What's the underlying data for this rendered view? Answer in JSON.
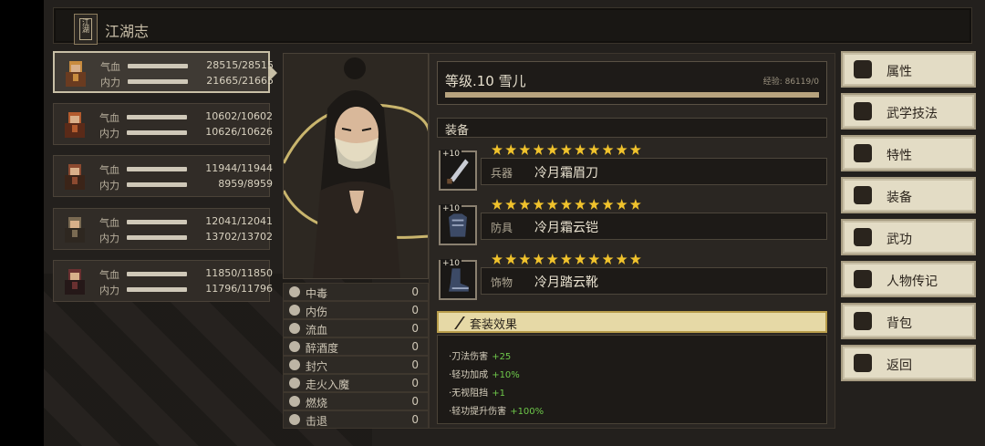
{
  "header": {
    "title": "江湖志",
    "book_icon": "book-icon"
  },
  "labels": {
    "hp": "气血",
    "mp": "内力"
  },
  "characters": [
    {
      "hp": "28515/28515",
      "mp": "21665/21665",
      "selected": true
    },
    {
      "hp": "10602/10602",
      "mp": "10626/10626"
    },
    {
      "hp": "11944/11944",
      "mp": "8959/8959"
    },
    {
      "hp": "12041/12041",
      "mp": "13702/13702"
    },
    {
      "hp": "11850/11850",
      "mp": "11796/11796"
    }
  ],
  "status_effects": [
    {
      "name": "中毒",
      "value": "0",
      "icon": "skull-icon"
    },
    {
      "name": "内伤",
      "value": "0",
      "icon": "broken-heart-icon"
    },
    {
      "name": "流血",
      "value": "0",
      "icon": "blood-drop-icon"
    },
    {
      "name": "醉酒度",
      "value": "0",
      "icon": "wine-icon"
    },
    {
      "name": "封穴",
      "value": "0",
      "icon": "needle-icon"
    },
    {
      "name": "走火入魔",
      "value": "0",
      "icon": "demon-icon"
    },
    {
      "name": "燃烧",
      "value": "0",
      "icon": "fire-icon"
    },
    {
      "name": "击退",
      "value": "0",
      "icon": "boot-icon"
    }
  ],
  "profile": {
    "level_name": "等级.10 雪儿",
    "exp": "经验: 86119/0",
    "exp_fill": 1.0
  },
  "equipment": {
    "section_title": "装备",
    "items": [
      {
        "plus": "+10",
        "stars": 11,
        "type": "兵器",
        "name": "冷月霜眉刀",
        "icon": "blade-icon"
      },
      {
        "plus": "+10",
        "stars": 11,
        "type": "防具",
        "name": "冷月霜云铠",
        "icon": "armor-icon"
      },
      {
        "plus": "+10",
        "stars": 11,
        "type": "饰物",
        "name": "冷月踏云靴",
        "icon": "boots-icon"
      }
    ]
  },
  "set_effect": {
    "title": "套装效果",
    "lines": [
      {
        "name": "·刀法伤害",
        "bonus": "+25"
      },
      {
        "name": "·轻功加成",
        "bonus": "+10%"
      },
      {
        "name": "·无视阻挡",
        "bonus": "+1"
      },
      {
        "name": "·轻功提升伤害",
        "bonus": "+100%"
      }
    ]
  },
  "menu": [
    {
      "label": "属性",
      "icon": "attribute-icon"
    },
    {
      "label": "武学技法",
      "icon": "martial-skill-icon"
    },
    {
      "label": "特性",
      "icon": "trait-icon"
    },
    {
      "label": "装备",
      "icon": "equipment-icon"
    },
    {
      "label": "武功",
      "icon": "manual-icon"
    },
    {
      "label": "人物传记",
      "icon": "biography-icon"
    },
    {
      "label": "背包",
      "icon": "bag-icon"
    },
    {
      "label": "返回",
      "icon": "door-icon"
    }
  ],
  "colors": {
    "star": "#f0c22c",
    "bonus": "#6ec84a",
    "set_bar": "#e6d9a6"
  }
}
